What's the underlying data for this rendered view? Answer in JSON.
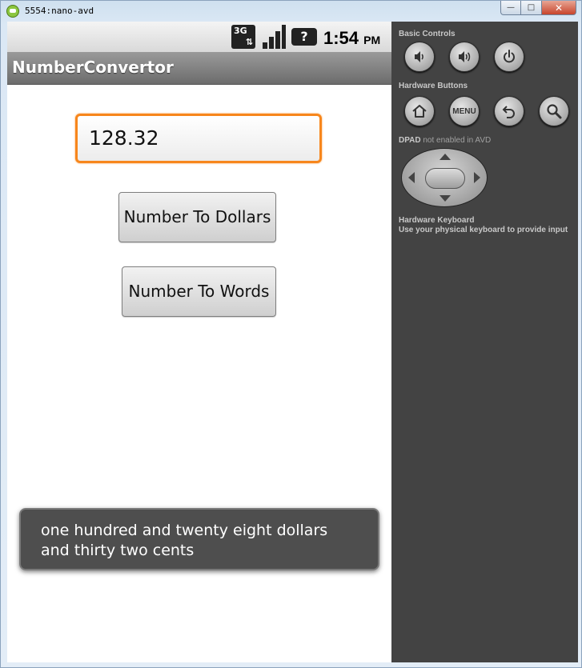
{
  "window": {
    "title": "5554:nano-avd"
  },
  "status_bar": {
    "network": "3G",
    "time": "1:54",
    "ampm": "PM"
  },
  "app": {
    "title": "NumberConvertor"
  },
  "input": {
    "value": "128.32"
  },
  "buttons": {
    "dollars": "Number To Dollars",
    "words": "Number To Words"
  },
  "toast": {
    "message": "one hundred and twenty eight dollars and thirty two cents"
  },
  "controls": {
    "basic_controls": "Basic Controls",
    "hardware_buttons": "Hardware Buttons",
    "menu_label": "MENU",
    "dpad_label": "DPAD",
    "dpad_note": "not enabled in AVD",
    "keyboard_title": "Hardware Keyboard",
    "keyboard_hint": "Use your physical keyboard to provide input"
  },
  "colors": {
    "input_focus": "#f7861c",
    "panel_bg": "#434343",
    "action_bar": "#808080"
  }
}
